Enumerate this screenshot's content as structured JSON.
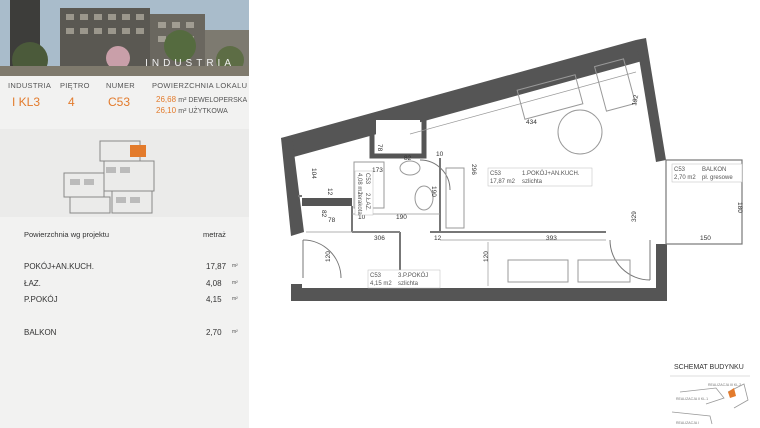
{
  "hero": {
    "brand": "INDUSTRIA"
  },
  "info": {
    "headers": [
      "INDUSTRIA",
      "PIĘTRO",
      "NUMER",
      "POWIERZCHNIA LOKALU"
    ],
    "values": {
      "building": "I KL3",
      "floor": "4",
      "number": "C53"
    },
    "area_dev": "26,68",
    "area_dev_label": "m² DEWELOPERSKA",
    "area_use": "26,10",
    "area_use_label": "m² UŻYTKOWA"
  },
  "areas": {
    "heading": "Powierzchnia wg projektu",
    "unit_heading": "metraż",
    "rows": [
      {
        "label": "POKÓJ+AN.KUCH.",
        "value": "17,87",
        "unit": "m²"
      },
      {
        "label": "ŁAZ.",
        "value": "4,08",
        "unit": "m²"
      },
      {
        "label": "P.POKÓJ",
        "value": "4,15",
        "unit": "m²"
      },
      {
        "label": "BALKON",
        "value": "2,70",
        "unit": "m²"
      }
    ]
  },
  "plan": {
    "rooms": [
      {
        "code": "C53",
        "name": "1.POKÓJ+AN.KUCH.",
        "area": "17,87 m2",
        "floor": "szlichta"
      },
      {
        "code": "C53",
        "name": "2.ŁAZ.",
        "area": "4,08 m2",
        "floor": "terakota"
      },
      {
        "code": "C53",
        "name": "3.P.POKÓJ",
        "area": "4,15 m2",
        "floor": "szlichta"
      },
      {
        "code": "C53",
        "name": "BALKON",
        "area": "2,70 m2",
        "floor": "pł. gresowe"
      }
    ],
    "dims": [
      "434",
      "192",
      "78",
      "173",
      "82",
      "10",
      "296",
      "104",
      "190",
      "12",
      "82",
      "78",
      "10",
      "190",
      "306",
      "12",
      "393",
      "329",
      "120",
      "120",
      "180",
      "150"
    ]
  },
  "schema": {
    "title": "SCHEMAT BUDYNKU",
    "labels": [
      "REALIZACJA III KL.2",
      "REALIZACJA II KL.1",
      "REALIZACJA I"
    ]
  }
}
